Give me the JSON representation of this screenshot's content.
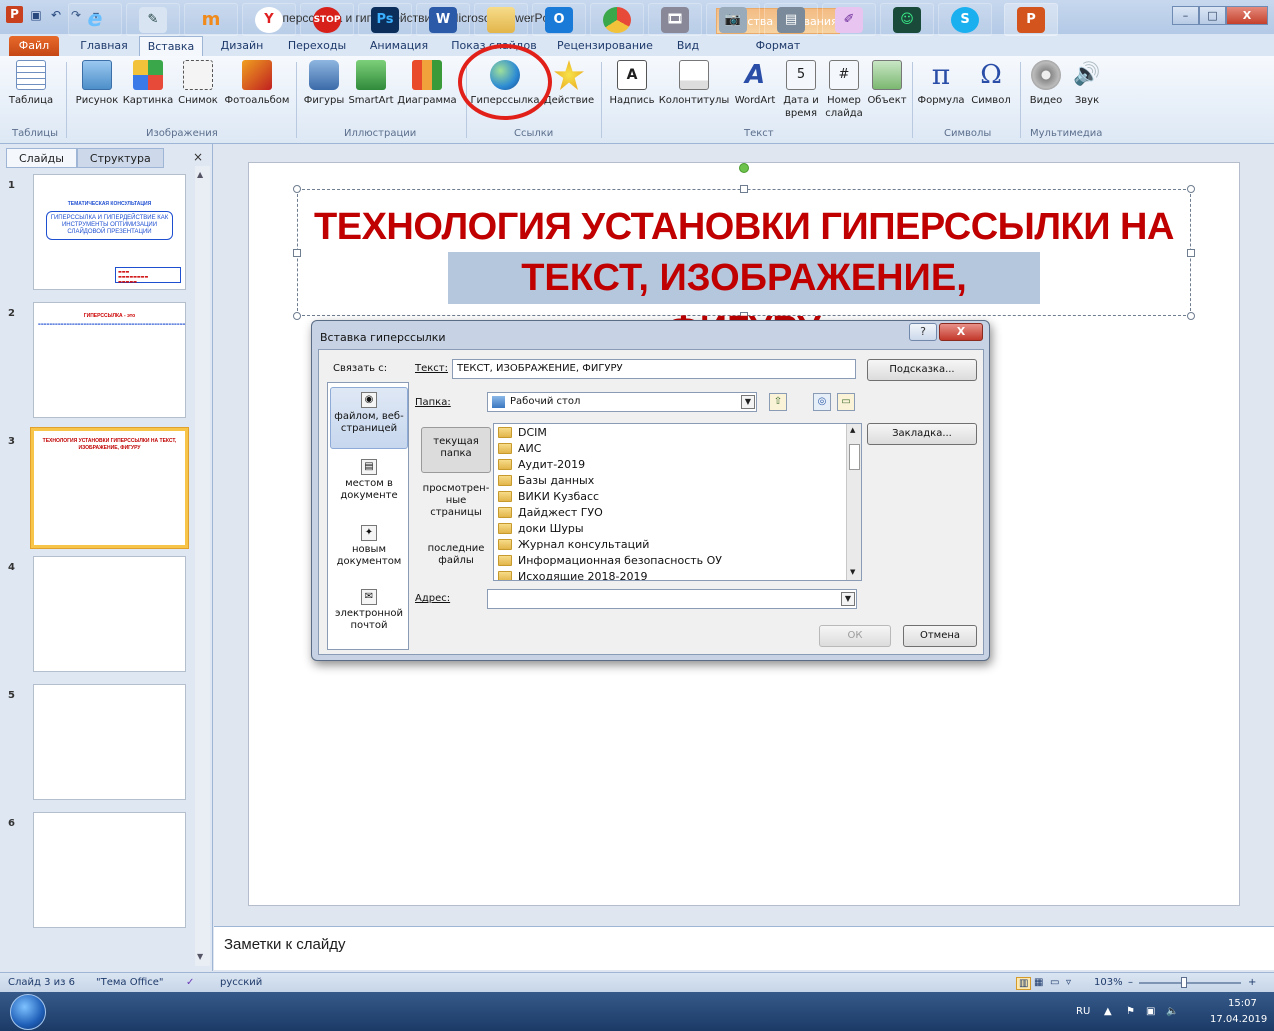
{
  "titlebar": {
    "app_logo": "P",
    "title": "Гиперссылка и гипердействие  -  Microsoft PowerPoint",
    "context_tool": "Средства рисования",
    "minimize": "–",
    "maximize": "□",
    "close": "X"
  },
  "ribbon_tabs": {
    "file": "Файл",
    "home": "Главная",
    "insert": "Вставка",
    "design": "Дизайн",
    "transitions": "Переходы",
    "animation": "Анимация",
    "slideshow": "Показ слайдов",
    "review": "Рецензирование",
    "view": "Вид",
    "format": "Формат"
  },
  "ribbon": {
    "table": "Таблица",
    "picture": "Рисунок",
    "clipart": "Картинка",
    "screenshot": "Снимок",
    "photoalbum": "Фотоальбом",
    "shapes": "Фигуры",
    "smartart": "SmartArt",
    "chart": "Диаграмма",
    "hyperlink": "Гиперссылка",
    "action": "Действие",
    "textbox": "Надпись",
    "headerfooter": "Колонтитулы",
    "wordart": "WordArt",
    "datetime": "Дата и время",
    "slidenumber": "Номер слайда",
    "object": "Объект",
    "equation": "Формула",
    "symbol": "Символ",
    "video": "Видео",
    "audio": "Звук",
    "groups": {
      "tables": "Таблицы",
      "images": "Изображения",
      "illustrations": "Иллюстрации",
      "links": "Ссылки",
      "text": "Текст",
      "symbols": "Символы",
      "media": "Мультимедиа"
    }
  },
  "leftpane": {
    "tab_slides": "Слайды",
    "tab_outline": "Структура",
    "close": "×",
    "thumbs": [
      {
        "num": "1",
        "title": "ТЕМАТИЧЕСКАЯ КОНСУЛЬТАЦИЯ",
        "box": "ГИПЕРССЫЛКА И ГИПЕРДЕЙСТВИЕ КАК ИНСТРУМЕНТЫ ОПТИМИЗАЦИИ СЛАЙДОВОЙ ПРЕЗЕНТАЦИИ"
      },
      {
        "num": "2",
        "title": "ГИПЕРССЫЛКА - это"
      },
      {
        "num": "3",
        "title": "ТЕХНОЛОГИЯ УСТАНОВКИ ГИПЕРССЫЛКИ НА ТЕКСТ, ИЗОБРАЖЕНИЕ, ФИГУРУ"
      },
      {
        "num": "4"
      },
      {
        "num": "5"
      },
      {
        "num": "6"
      }
    ]
  },
  "slide": {
    "title_line1": "ТЕХНОЛОГИЯ УСТАНОВКИ ГИПЕРССЫЛКИ НА",
    "title_line2": "ТЕКСТ, ИЗОБРАЖЕНИЕ, ФИГУРУ"
  },
  "dialog": {
    "title": "Вставка гиперссылки",
    "help": "?",
    "close": "X",
    "link_to_label": "Связать с:",
    "text_label": "Текст:",
    "text_value": "ТЕКСТ, ИЗОБРАЖЕНИЕ, ФИГУРУ",
    "screentip_button": "Подсказка...",
    "folder_label": "Папка:",
    "folder_value": "Рабочий стол",
    "bookmark_button": "Закладка...",
    "link_items": [
      {
        "label": "файлом, веб-страницей"
      },
      {
        "label": "местом в документе"
      },
      {
        "label": "новым документом"
      },
      {
        "label": "электронной почтой"
      }
    ],
    "nav_items": [
      {
        "label": "текущая папка"
      },
      {
        "label": "просмотрен-ные страницы"
      },
      {
        "label": "последние файлы"
      }
    ],
    "files": [
      "DCIM",
      "АИС",
      "Аудит-2019",
      "Базы данных",
      "ВИКИ Кузбасс",
      "Дайджест ГУО",
      "доки Шуры",
      "Журнал консультаций",
      "Информационная безопасность ОУ",
      "Исходящие 2018-2019"
    ],
    "address_label": "Адрес:",
    "address_value": "",
    "ok_button": "ОК",
    "cancel_button": "Отмена"
  },
  "notes": {
    "placeholder": "Заметки к слайду"
  },
  "statusbar": {
    "slide_info": "Слайд 3 из 6",
    "theme": "\"Тема Office\"",
    "language": "русский",
    "zoom": "103%",
    "zoom_minus": "–",
    "zoom_plus": "+"
  },
  "taskbar": {
    "lang": "RU",
    "time": "15:07",
    "date": "17.04.2019"
  },
  "colors": {
    "slide_title": "#c00000",
    "highlight": "#b4c7dc",
    "annotation_circle": "#e2201a",
    "file_tab": "#d4541d"
  }
}
